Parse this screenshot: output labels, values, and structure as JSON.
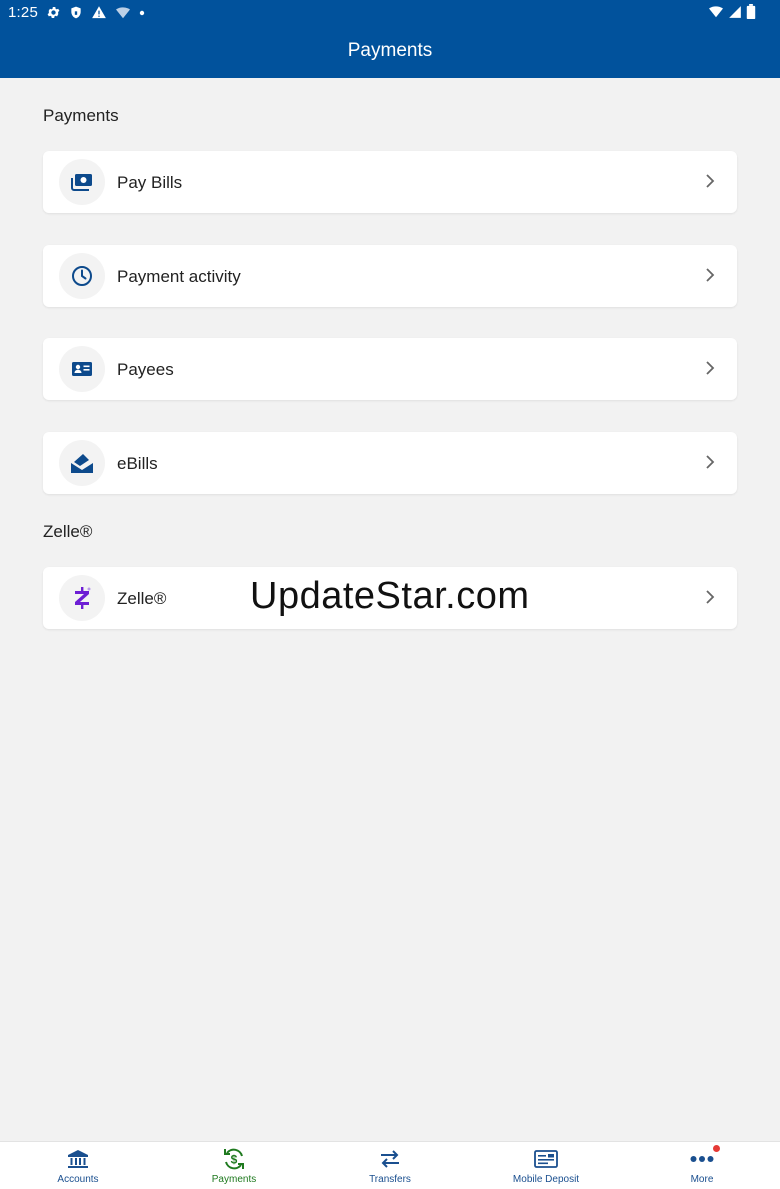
{
  "status": {
    "time": "1:25"
  },
  "appbar": {
    "title": "Payments"
  },
  "sections": {
    "payments": "Payments",
    "zelle": "Zelle®"
  },
  "payments_items": [
    {
      "label": "Pay Bills",
      "icon": "bill-icon"
    },
    {
      "label": "Payment activity",
      "icon": "clock-icon"
    },
    {
      "label": "Payees",
      "icon": "contact-card-icon"
    },
    {
      "label": "eBills",
      "icon": "envelope-icon"
    }
  ],
  "zelle_items": [
    {
      "label": "Zelle®",
      "icon": "zelle-icon"
    }
  ],
  "watermark": "UpdateStar.com",
  "bottom_nav": [
    {
      "label": "Accounts",
      "icon": "bank-icon",
      "active": false
    },
    {
      "label": "Payments",
      "icon": "payments-icon",
      "active": true
    },
    {
      "label": "Transfers",
      "icon": "transfer-icon",
      "active": false
    },
    {
      "label": "Mobile Deposit",
      "icon": "check-deposit-icon",
      "active": false
    },
    {
      "label": "More",
      "icon": "more-dots-icon",
      "active": false
    }
  ],
  "colors": {
    "brand": "#01529c",
    "icon": "#0d4a8c",
    "active_nav": "#1f7a1f",
    "zelle": "#6d1ed4",
    "badge": "#e53935"
  }
}
